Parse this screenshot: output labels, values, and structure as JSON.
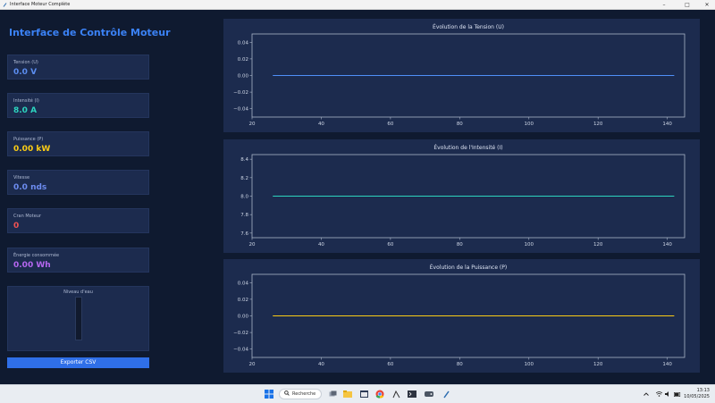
{
  "window": {
    "title": "Interface Moteur Complète"
  },
  "app": {
    "title": "Interface de Contrôle Moteur"
  },
  "metrics": [
    {
      "label": "Tension (U)",
      "value": "0.0 V",
      "color": "#5b8def"
    },
    {
      "label": "Intensité (I)",
      "value": "8.0 A",
      "color": "#2dd4bf"
    },
    {
      "label": "Puissance (P)",
      "value": "0.00 kW",
      "color": "#facc15"
    },
    {
      "label": "Vitesse",
      "value": "0.0 nds",
      "color": "#6d8cf0"
    },
    {
      "label": "Cran Moteur",
      "value": "0",
      "color": "#f05252"
    },
    {
      "label": "Énergie consommée",
      "value": "0.00 Wh",
      "color": "#b567f0"
    }
  ],
  "water_level": {
    "label": "Niveau d'eau",
    "fill": 0
  },
  "export_button": {
    "label": "Exporter CSV"
  },
  "chart_data": [
    {
      "type": "line",
      "title": "Évolution de la Tension (U)",
      "x": [
        26,
        142
      ],
      "series": [
        {
          "values": [
            0,
            0
          ],
          "color": "#4f8ff7"
        }
      ],
      "xlim": [
        20,
        145
      ],
      "ylim": [
        -0.05,
        0.05
      ],
      "xticks": [
        20,
        40,
        60,
        80,
        100,
        120,
        140
      ],
      "yticks": [
        0.04,
        0.02,
        0.0,
        -0.02,
        -0.04
      ],
      "ytick_labels": [
        "0.04",
        "0.02",
        "0.00",
        "−0.02",
        "−0.04"
      ],
      "grid": false
    },
    {
      "type": "line",
      "title": "Évolution de l'Intensité (I)",
      "x": [
        26,
        142
      ],
      "series": [
        {
          "values": [
            8.0,
            8.0
          ],
          "color": "#2dd4bf"
        }
      ],
      "xlim": [
        20,
        145
      ],
      "ylim": [
        7.55,
        8.45
      ],
      "xticks": [
        20,
        40,
        60,
        80,
        100,
        120,
        140
      ],
      "yticks": [
        8.4,
        8.2,
        8.0,
        7.8,
        7.6
      ],
      "ytick_labels": [
        "8.4",
        "8.2",
        "8.0",
        "7.8",
        "7.6"
      ],
      "grid": false
    },
    {
      "type": "line",
      "title": "Évolution de la Puissance (P)",
      "x": [
        26,
        142
      ],
      "series": [
        {
          "values": [
            0,
            0
          ],
          "color": "#facc15"
        }
      ],
      "xlim": [
        20,
        145
      ],
      "ylim": [
        -0.05,
        0.05
      ],
      "xticks": [
        20,
        40,
        60,
        80,
        100,
        120,
        140
      ],
      "yticks": [
        0.04,
        0.02,
        0.0,
        -0.02,
        -0.04
      ],
      "ytick_labels": [
        "0.04",
        "0.02",
        "0.00",
        "−0.02",
        "−0.04"
      ],
      "grid": false
    }
  ],
  "taskbar": {
    "search_label": "Recherche",
    "time": "13:13",
    "date": "10/05/2025"
  }
}
